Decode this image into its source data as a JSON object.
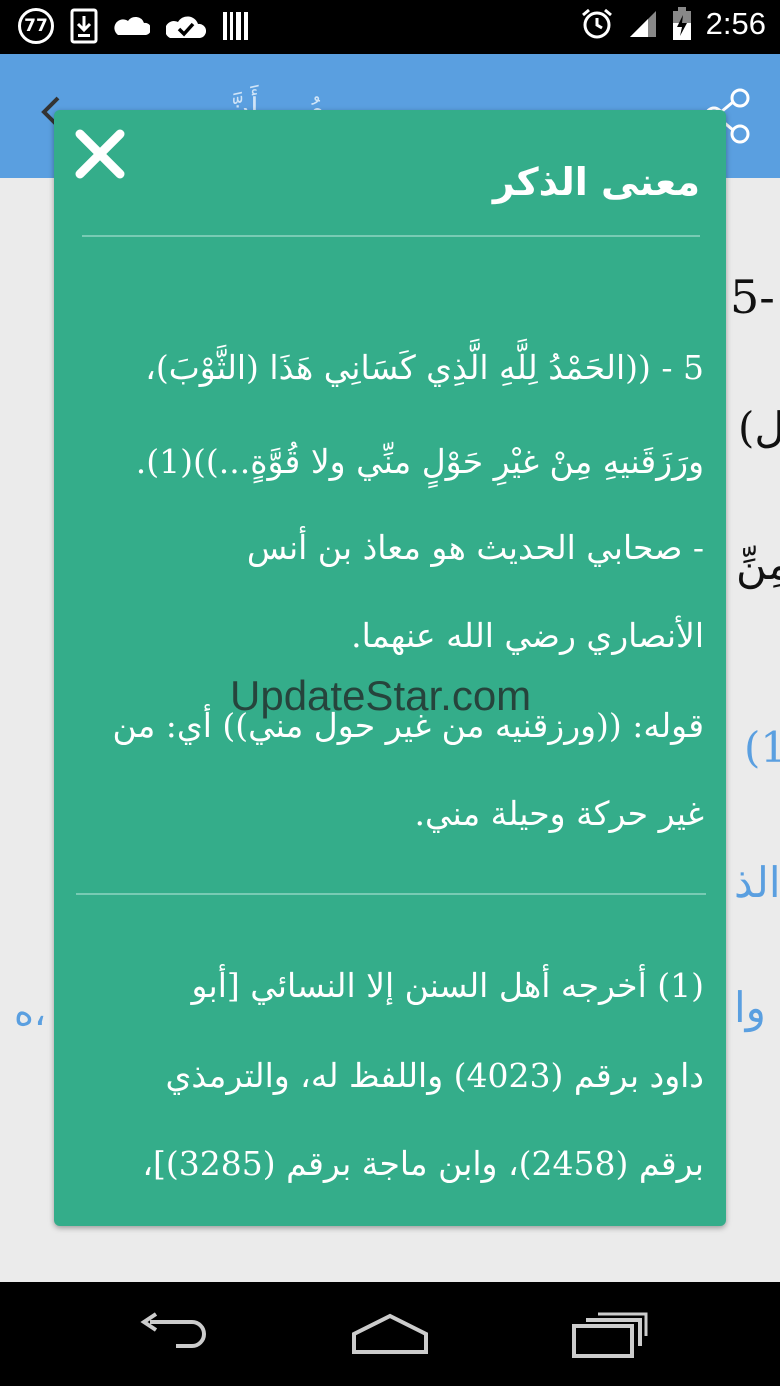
{
  "status_bar": {
    "notification_count": "77",
    "time": "2:56",
    "icons": [
      "download-icon",
      "cloud-icon",
      "sync-check-icon",
      "barcode-icon",
      "alarm-icon",
      "signal-icon",
      "battery-charging-icon"
    ]
  },
  "app_bar": {
    "faded_title": "... مُ ... أَنَّ",
    "icons": [
      "back-arrow-icon",
      "share-icon"
    ]
  },
  "background": {
    "fragments": [
      "5-",
      "(ال",
      "مِنِّ",
      "(1",
      "الذ",
      "وا",
      "ه،"
    ],
    "link_color": "#5a9fe0"
  },
  "dialog": {
    "title": "معنى الذكر",
    "body_lines": [
      "5 - ((الحَمْدُ لِلَّهِ الَّذِي كَسَانِي هَذَا (الثَّوْبَ)،",
      "ورَزَقَنيهِ مِنْ غيْرِ حَوْلٍ منِّي ولا قُوَّةٍ...))(1).",
      "- صحابي الحديث هو معاذ بن أنس",
      "الأنصاري رضي الله عنهما.",
      "قوله: ((ورزقنيه من غير حول مني)) أي: من",
      "غير حركة وحيلة مني."
    ],
    "footnote_lines": [
      "(1)  أخرجه أهل السنن إلا النسائي [أبو",
      "داود برقم (4023) واللفظ له، والترمذي",
      "برقم (2458)، وابن ماجة برقم (3285)]،"
    ],
    "background_color": "#34ad8a",
    "close_icon": "close-icon"
  },
  "watermark": "UpdateStar.com",
  "nav_bar": {
    "icons": [
      "back-icon",
      "home-icon",
      "recents-icon"
    ]
  }
}
